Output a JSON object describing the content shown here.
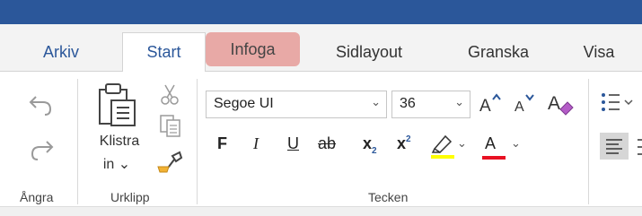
{
  "tabs": [
    {
      "label": "Arkiv"
    },
    {
      "label": "Start"
    },
    {
      "label": "Infoga"
    },
    {
      "label": "Sidlayout"
    },
    {
      "label": "Granska"
    },
    {
      "label": "Visa"
    }
  ],
  "groups": {
    "undo": {
      "label": "Ångra"
    },
    "clipboard": {
      "label": "Urklipp",
      "paste_label_line1": "Klistra",
      "paste_label_line2": "in ⌄"
    },
    "font": {
      "label": "Tecken",
      "font_name": "Segoe UI",
      "font_size": "36",
      "bold": "F",
      "italic": "I",
      "underline": "U",
      "strike": "ab",
      "subscript_base": "x",
      "subscript_mark": "2",
      "superscript_base": "x",
      "superscript_mark": "2",
      "font_color_letter": "A"
    }
  },
  "colors": {
    "titlebar": "#2b579a",
    "tab_text": "#2b579a",
    "infoga_highlight": "#e8a9a6",
    "highlight_yellow": "#ffff00",
    "font_color_red": "#e81123"
  },
  "icons": [
    "undo-icon",
    "redo-icon",
    "paste-icon",
    "cut-icon",
    "copy-icon",
    "format-painter-icon",
    "grow-font-icon",
    "shrink-font-icon",
    "clear-formatting-icon",
    "highlighter-icon",
    "bullets-icon",
    "align-left-icon"
  ]
}
